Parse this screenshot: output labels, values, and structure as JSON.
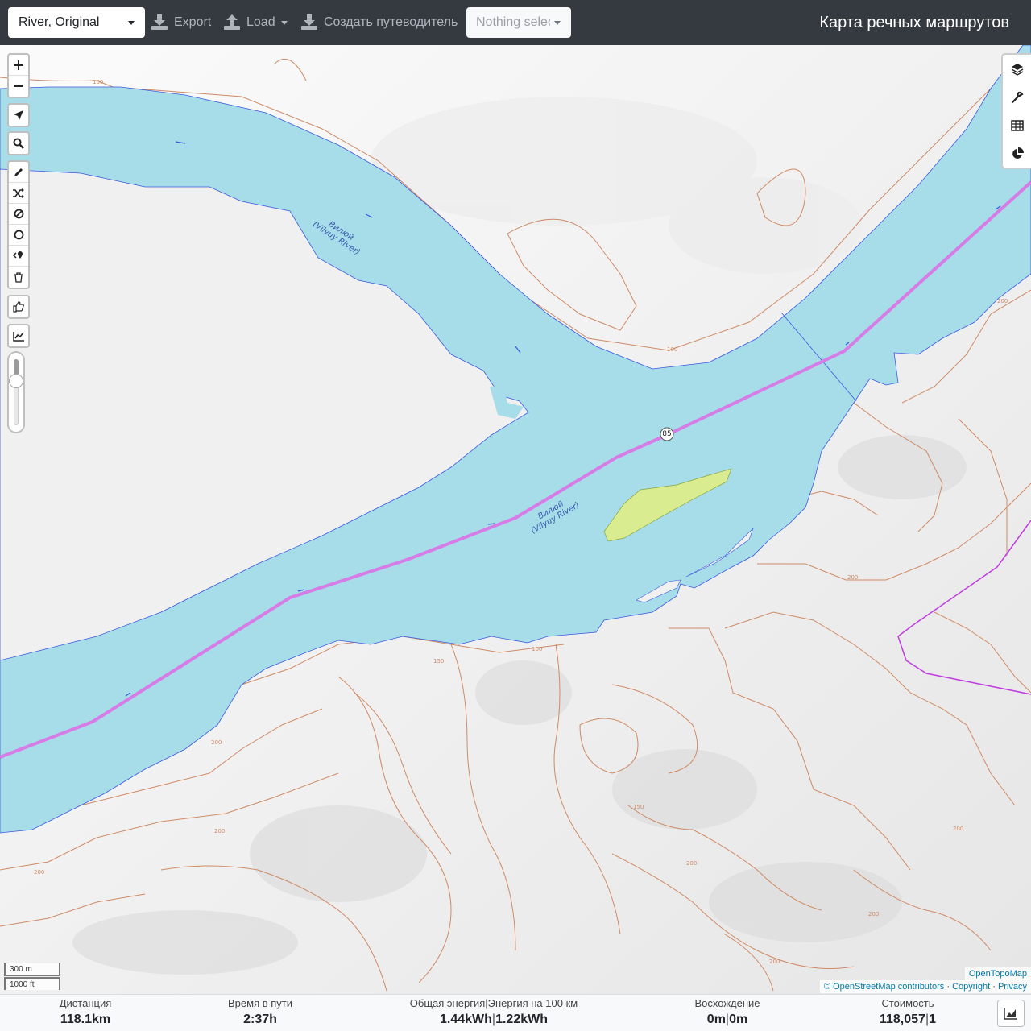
{
  "topbar": {
    "profile_select": "River, Original",
    "export_label": "Export",
    "load_label": "Load",
    "create_guide_label": "Создать путеводитель",
    "route_select_placeholder": "Nothing selected",
    "app_title": "Карта речных маршрутов"
  },
  "map": {
    "river_label_top": "Вилюй",
    "river_label_top_en": "(Vilyuy River)",
    "river_label_mid": "Вилюй",
    "river_label_mid_en": "(Vilyuy River)",
    "route_marker": "85",
    "contour_labels": [
      "100",
      "150",
      "200"
    ],
    "scale_metric": "300 m",
    "scale_imperial": "1000 ft",
    "attribution_top": "OpenTopoMap",
    "attribution_osm": "© OpenStreetMap contributors",
    "attribution_copyright": "Copyright",
    "attribution_privacy": "Privacy",
    "left_controls": [
      "zoom-in",
      "zoom-out",
      "locate",
      "search",
      "draw",
      "reverse",
      "no-go",
      "circle",
      "poi",
      "delete",
      "vote",
      "elevation"
    ],
    "right_controls": [
      "layers-icon",
      "wrench-icon",
      "table-icon",
      "pie-chart-icon"
    ]
  },
  "stats": {
    "distance_label": "Дистанция",
    "distance_value": "118.1",
    "distance_unit": "km",
    "time_label": "Время в пути",
    "time_value": "2:37",
    "time_unit": "h",
    "energy_label": "Общая энергия|Энергия на 100 км",
    "energy_total": "1.44",
    "energy_total_unit": "kWh",
    "energy_per100": "1.22",
    "energy_per100_unit": "kWh",
    "ascent_label": "Восхождение",
    "ascent_up": "0",
    "ascent_up_unit": "m",
    "ascent_down": "0",
    "ascent_down_unit": "m",
    "cost_label": "Стоимость",
    "cost_value": "118,057",
    "cost_count": "1"
  },
  "colors": {
    "water": "#a6dde8",
    "route": "#d77be6",
    "contour": "#cf8a66",
    "island": "#d9ec8f",
    "topbar": "#343a40"
  }
}
